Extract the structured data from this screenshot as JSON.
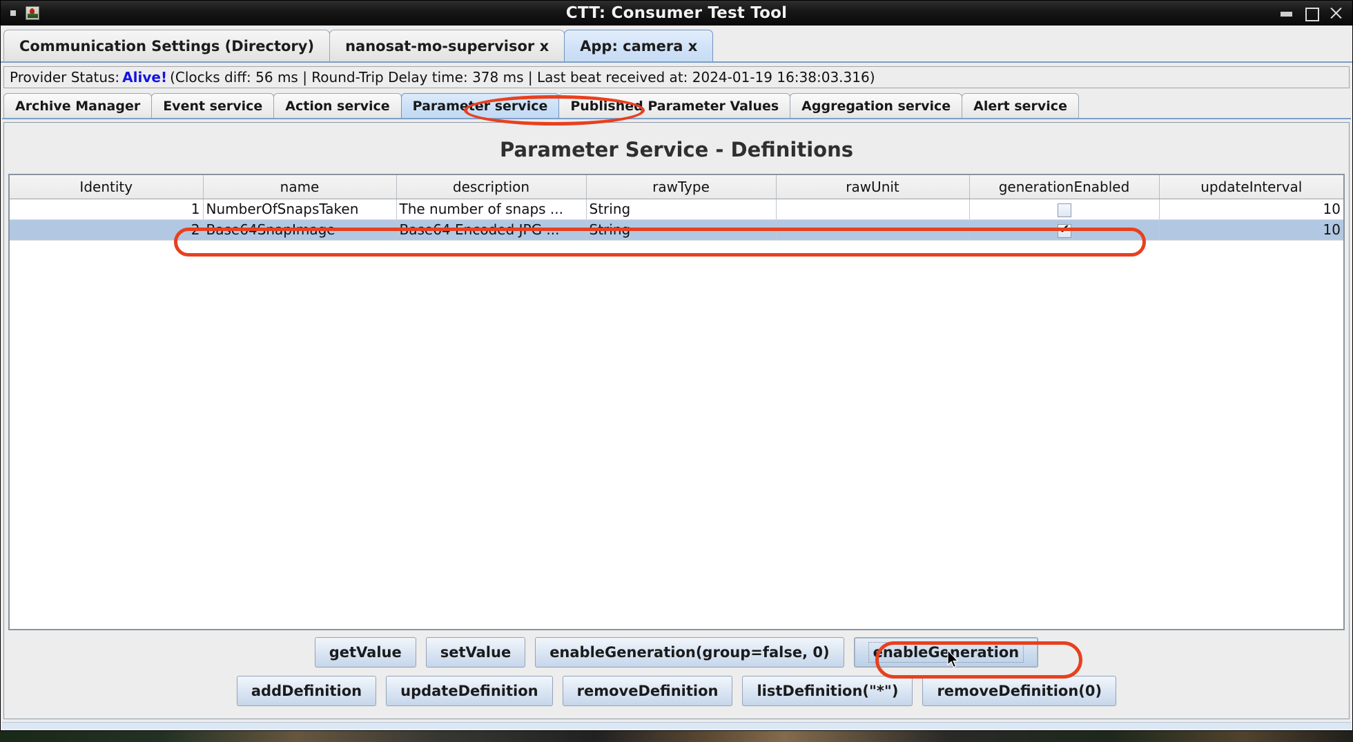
{
  "window": {
    "title": "CTT: Consumer Test Tool",
    "app_icon": "app-icon",
    "controls": {
      "minimize": "minimize",
      "maximize": "maximize",
      "close": "close"
    }
  },
  "app_tabs": [
    {
      "label": "Communication Settings (Directory)",
      "active": false
    },
    {
      "label": "nanosat-mo-supervisor x",
      "active": false
    },
    {
      "label": "App: camera x",
      "active": true
    }
  ],
  "status": {
    "prefix": "Provider Status:",
    "state": "Alive!",
    "details": "(Clocks diff: 56 ms | Round-Trip Delay time: 378 ms | Last beat received at: 2024-01-19 16:38:03.316)"
  },
  "service_tabs": [
    {
      "label": "Archive Manager",
      "active": false
    },
    {
      "label": "Event service",
      "active": false
    },
    {
      "label": "Action service",
      "active": false
    },
    {
      "label": "Parameter service",
      "active": true
    },
    {
      "label": "Published Parameter Values",
      "active": false
    },
    {
      "label": "Aggregation service",
      "active": false
    },
    {
      "label": "Alert service",
      "active": false
    }
  ],
  "panel": {
    "title": "Parameter Service - Definitions"
  },
  "table": {
    "columns": [
      "Identity",
      "name",
      "description",
      "rawType",
      "rawUnit",
      "generationEnabled",
      "updateInterval"
    ],
    "rows": [
      {
        "identity": "1",
        "name": "NumberOfSnapsTaken",
        "description": "The number of snaps ...",
        "rawType": "String",
        "rawUnit": "",
        "generationEnabled": false,
        "updateInterval": "10",
        "selected": false
      },
      {
        "identity": "2",
        "name": "Base64SnapImage",
        "description": "Base64 Encoded JPG ...",
        "rawType": "String",
        "rawUnit": "",
        "generationEnabled": true,
        "updateInterval": "10",
        "selected": true
      }
    ]
  },
  "buttons": {
    "row1": [
      {
        "label": "getValue",
        "focused": false
      },
      {
        "label": "setValue",
        "focused": false
      },
      {
        "label": "enableGeneration(group=false, 0)",
        "focused": false
      },
      {
        "label": "enableGeneration",
        "focused": true
      }
    ],
    "row2": [
      {
        "label": "addDefinition",
        "focused": false
      },
      {
        "label": "updateDefinition",
        "focused": false
      },
      {
        "label": "removeDefinition",
        "focused": false
      },
      {
        "label": "listDefinition(\"*\")",
        "focused": false
      },
      {
        "label": "removeDefinition(0)",
        "focused": false
      }
    ]
  },
  "annotations": {
    "accent_color": "#e8401f",
    "highlighted": [
      "Parameter service tab",
      "Base64SnapImage row",
      "enableGeneration button"
    ]
  }
}
